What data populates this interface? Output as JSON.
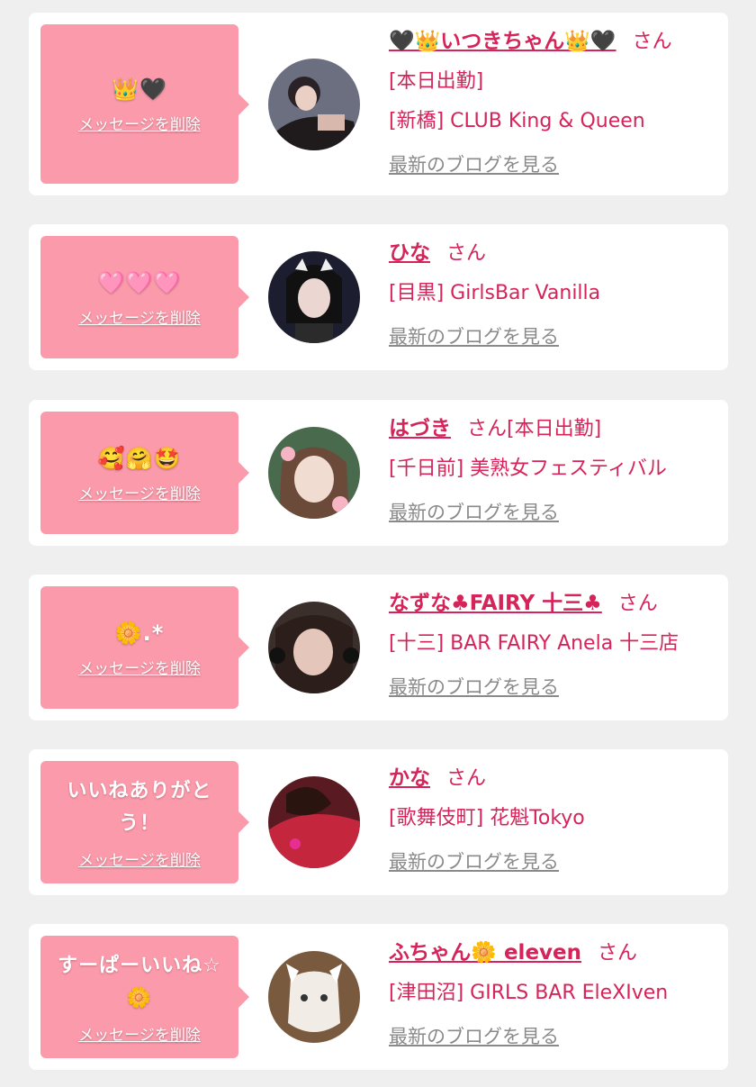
{
  "delete_label": "メッセージを削除",
  "blog_label": "最新のブログを見る",
  "san": "さん",
  "cards": [
    {
      "message": "👑🖤",
      "name": "🖤👑いつきちゃん👑🖤",
      "status": "[本日出勤]",
      "shop": "[新橋] CLUB King & Queen"
    },
    {
      "message": "🩷🩷🩷",
      "name": "ひな",
      "shop": "[目黒] GirlsBar Vanilla"
    },
    {
      "message": "🥰🤗🤩",
      "name": "はづき",
      "status": "[本日出勤]",
      "shop": "[千日前] 美熟女フェスティバル"
    },
    {
      "message": "🌼.*",
      "name": "なずな♣FAIRY 十三♣",
      "shop": "[十三] BAR FAIRY Anela 十三店"
    },
    {
      "message": "いいねありがとう！",
      "name": "かな",
      "shop": "[歌舞伎町] 花魁Tokyo"
    },
    {
      "message": "すーぱーいいね☆🌼",
      "name": "ふちゃん🌼 eleven",
      "shop": "[津田沼] GIRLS BAR EleXIven"
    }
  ]
}
